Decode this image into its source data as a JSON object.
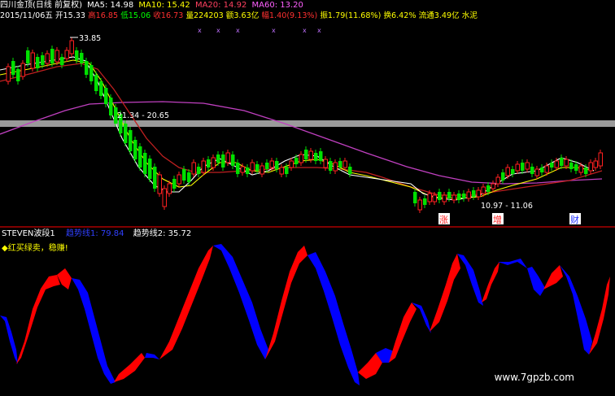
{
  "header": {
    "title": "四川金顶(日线 前复权)",
    "ma5": "MA5: 14.98",
    "ma10": "MA10: 15.42",
    "ma20": "MA20: 14.92",
    "ma60": "MA60: 13.20"
  },
  "info_bar": {
    "date": "2015/11/06五",
    "open": "开15.33",
    "high": "高16.85",
    "low": "低15.06",
    "close": "收16.73",
    "volume": "量224203",
    "amount": "额3.63亿",
    "change": "幅1.40(9.13%)",
    "amplitude": "振1.79(11.68%)",
    "turnover": "换6.42%",
    "float_shares": "流通3.49亿",
    "sector": "水泥"
  },
  "annotations": {
    "peak_price": "33.85",
    "range_1": "21.34 - 20.65",
    "range_2": "10.97 - 11.06",
    "marker_zhang": "涨",
    "marker_zeng": "增",
    "marker_cai": "财"
  },
  "indicator": {
    "name": "STEVEN波段1",
    "line1": "趋势线1: 79.84",
    "line2": "趋势线2: 35.72",
    "hint": "◆红买绿卖，稳赚!"
  },
  "watermark": "www.7gpzb.com",
  "colors": {
    "background": "#000000",
    "up": "#ff2020",
    "down": "#00e000",
    "ma5": "#ffffff",
    "ma10": "#ffff00",
    "ma20": "#c02020",
    "ma60": "#c040c0",
    "osc_up": "#ff0000",
    "osc_down": "#0000ff",
    "divider": "#aa0000"
  }
}
